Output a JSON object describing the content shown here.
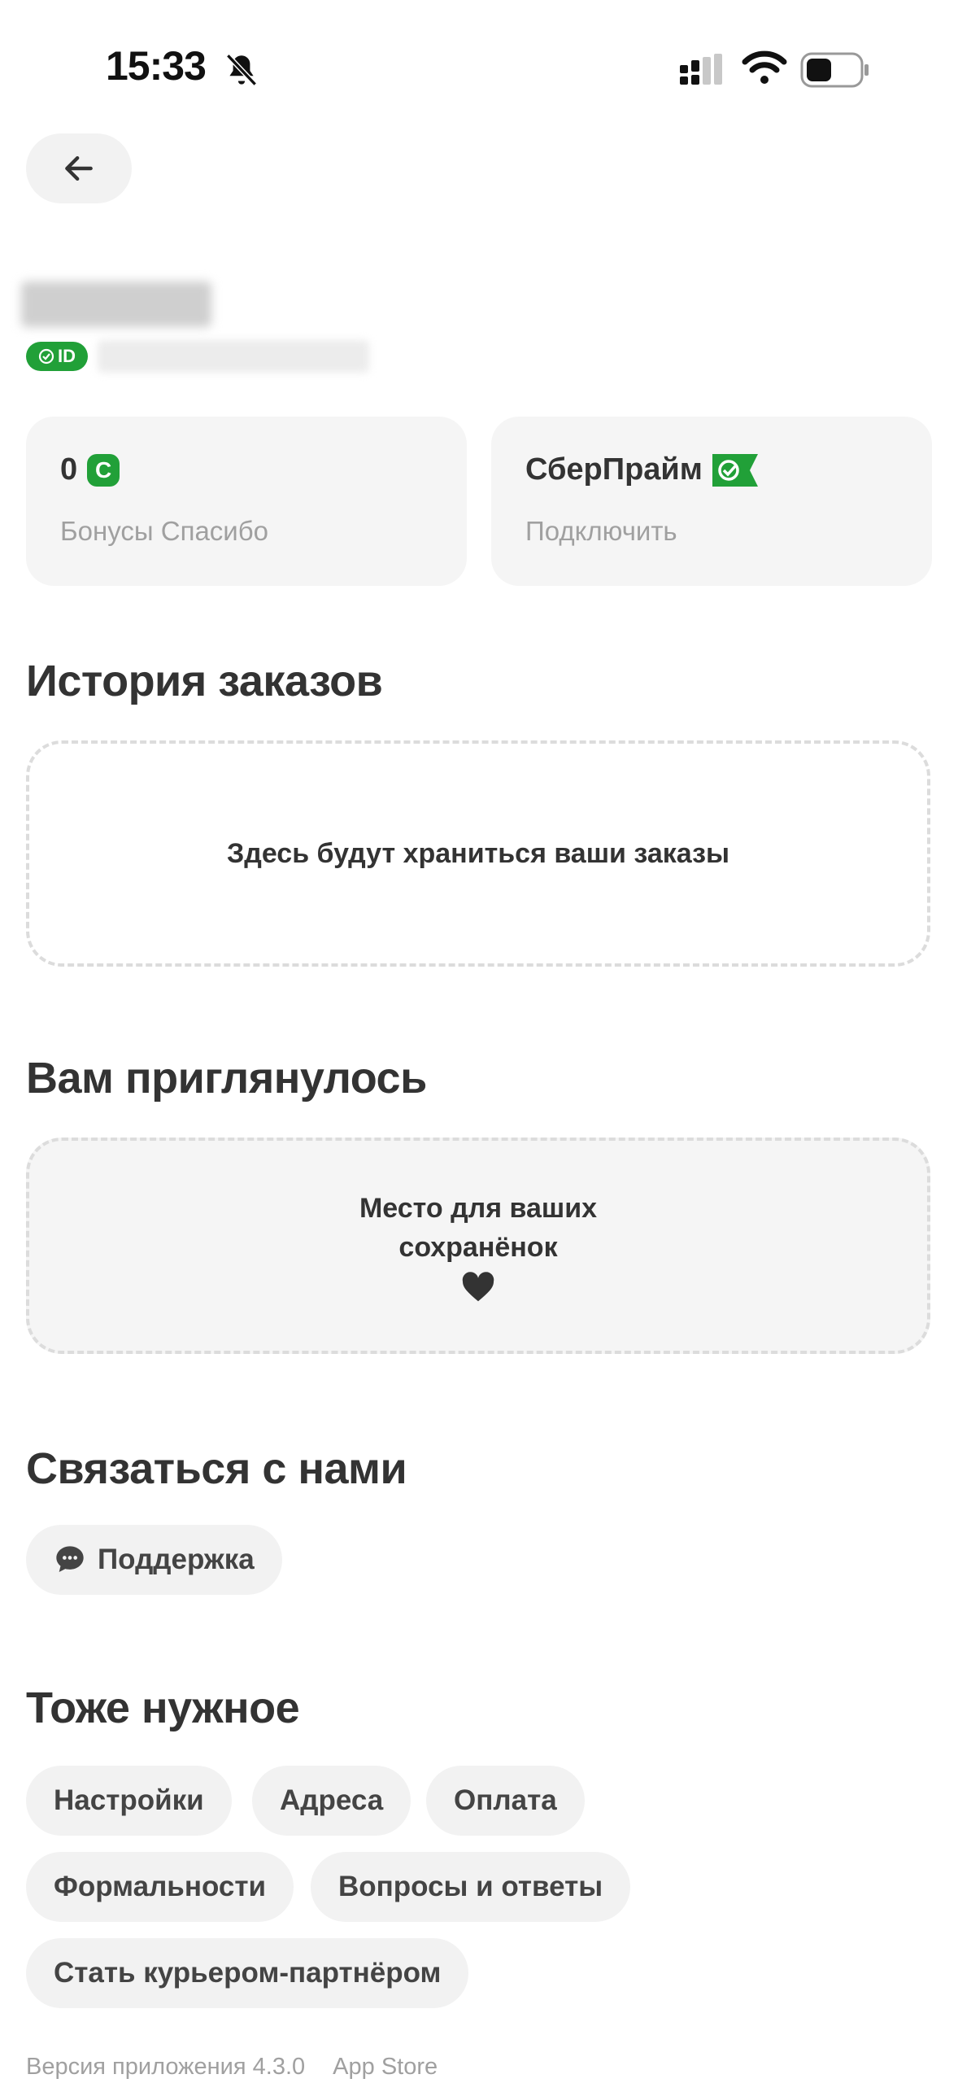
{
  "status_bar": {
    "time": "15:33"
  },
  "profile": {
    "id_badge": "ID"
  },
  "bonus_card": {
    "value": "0",
    "currency_badge": "С",
    "label": "Бонусы Спасибо"
  },
  "prime_card": {
    "title": "СберПрайм",
    "action": "Подключить"
  },
  "orders": {
    "title": "История заказов",
    "empty_text": "Здесь будут храниться ваши заказы"
  },
  "favorites": {
    "title": "Вам приглянулось",
    "empty_line1": "Место для ваших",
    "empty_line2": "сохранёнок"
  },
  "contact": {
    "title": "Связаться с нами",
    "support_label": "Поддержка"
  },
  "other": {
    "title": "Тоже нужное",
    "links": [
      "Настройки",
      "Адреса",
      "Оплата",
      "Формальности",
      "Вопросы и ответы",
      "Стать курьером-партнёром"
    ]
  },
  "footer": {
    "version": "Версия приложения 4.3.0",
    "store": "App Store"
  },
  "colors": {
    "brand_green": "#21a038",
    "chip_bg": "#f2f2f2",
    "card_bg": "#f5f5f5"
  }
}
